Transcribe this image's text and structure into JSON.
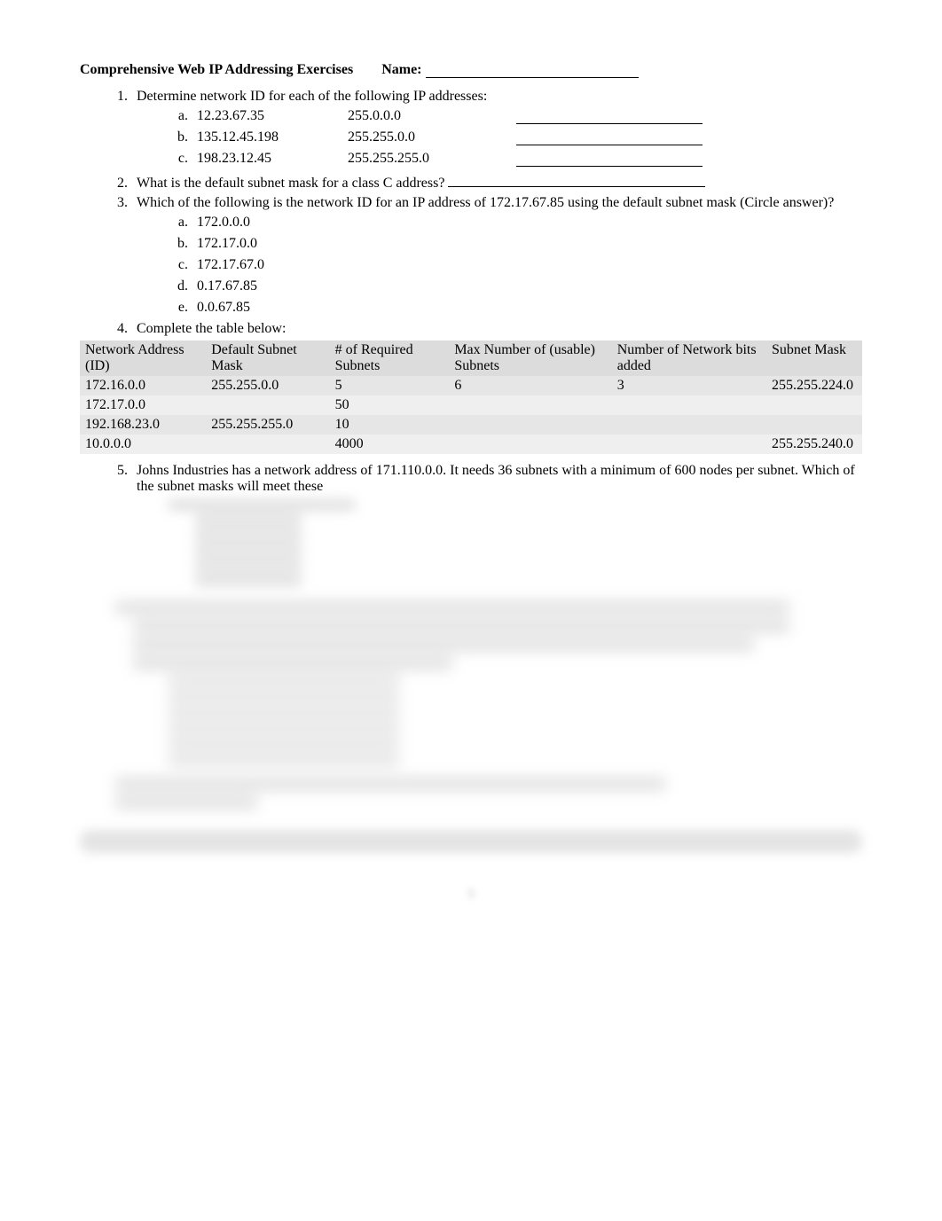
{
  "header": {
    "title": "Comprehensive Web IP Addressing Exercises",
    "name_label": "Name:"
  },
  "q1": {
    "prompt": "Determine network ID for each of the following IP addresses:",
    "rows": [
      {
        "ip": "12.23.67.35",
        "mask": "255.0.0.0"
      },
      {
        "ip": "135.12.45.198",
        "mask": "255.255.0.0"
      },
      {
        "ip": "198.23.12.45",
        "mask": "255.255.255.0"
      }
    ]
  },
  "q2": {
    "prompt": "What is the default subnet mask for a class C address?"
  },
  "q3": {
    "prompt": "Which of the following is the network ID for an IP address of 172.17.67.85 using the default subnet mask (Circle answer)?",
    "options": [
      "172.0.0.0",
      "172.17.0.0",
      "172.17.67.0",
      "0.17.67.85",
      "0.0.67.85"
    ]
  },
  "q4": {
    "prompt": "Complete the table below:",
    "headers": [
      "Network Address (ID)",
      "Default Subnet Mask",
      "# of Required Subnets",
      "Max Number of (usable) Subnets",
      "Number of Network bits added",
      "Subnet Mask"
    ],
    "rows": [
      {
        "addr": "172.16.0.0",
        "defmask": "255.255.0.0",
        "req": "5",
        "max": "6",
        "bits": "3",
        "mask": "255.255.224.0"
      },
      {
        "addr": "172.17.0.0",
        "defmask": "",
        "req": "50",
        "max": "",
        "bits": "",
        "mask": ""
      },
      {
        "addr": "192.168.23.0",
        "defmask": "255.255.255.0",
        "req": "10",
        "max": "",
        "bits": "",
        "mask": ""
      },
      {
        "addr": "10.0.0.0",
        "defmask": "",
        "req": "4000",
        "max": "",
        "bits": "",
        "mask": "255.255.240.0"
      }
    ]
  },
  "q5": {
    "prompt": "Johns Industries has a network address of 171.110.0.0.  It needs 36 subnets with a minimum of 600 nodes per subnet. Which of the subnet masks will meet these"
  }
}
